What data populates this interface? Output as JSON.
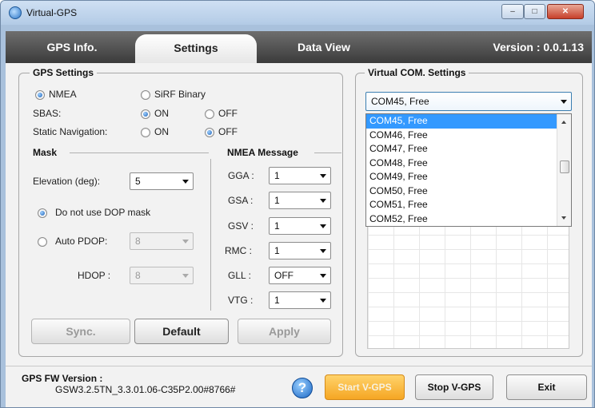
{
  "window": {
    "title": "Virtual-GPS",
    "min": "–",
    "max": "□",
    "close": "✕"
  },
  "tabs": [
    {
      "label": "GPS Info."
    },
    {
      "label": "Settings"
    },
    {
      "label": "Data View"
    }
  ],
  "version": "Version : 0.0.1.13",
  "gps_settings": {
    "title": "GPS Settings",
    "nmea": "NMEA",
    "sirf": "SiRF Binary",
    "sbas_label": "SBAS:",
    "on": "ON",
    "off": "OFF",
    "static_label": "Static Navigation:"
  },
  "mask": {
    "title": "Mask",
    "elevation_label": "Elevation (deg):",
    "elevation_value": "5",
    "no_dop": "Do not use DOP mask",
    "auto_pdop": "Auto PDOP:",
    "pdop_value": "8",
    "hdop_label": "HDOP :",
    "hdop_value": "8"
  },
  "nmea_message": {
    "title": "NMEA Message",
    "rows": [
      {
        "label": "GGA :",
        "value": "1"
      },
      {
        "label": "GSA :",
        "value": "1"
      },
      {
        "label": "GSV :",
        "value": "1"
      },
      {
        "label": "RMC :",
        "value": "1"
      },
      {
        "label": "GLL :",
        "value": "OFF"
      },
      {
        "label": "VTG :",
        "value": "1"
      }
    ]
  },
  "buttons": {
    "sync": "Sync.",
    "default": "Default",
    "apply": "Apply"
  },
  "virtual_com": {
    "title": "Virtual COM. Settings",
    "selected": "COM45, Free",
    "options": [
      "COM45, Free",
      "COM46, Free",
      "COM47, Free",
      "COM48, Free",
      "COM49, Free",
      "COM50, Free",
      "COM51, Free",
      "COM52, Free"
    ]
  },
  "status": {
    "fw_title": "GPS FW Version :",
    "fw_value": "GSW3.2.5TN_3.3.01.06-C35P2.00#8766#",
    "help": "?",
    "start": "Start V-GPS",
    "stop": "Stop V-GPS",
    "exit": "Exit"
  }
}
